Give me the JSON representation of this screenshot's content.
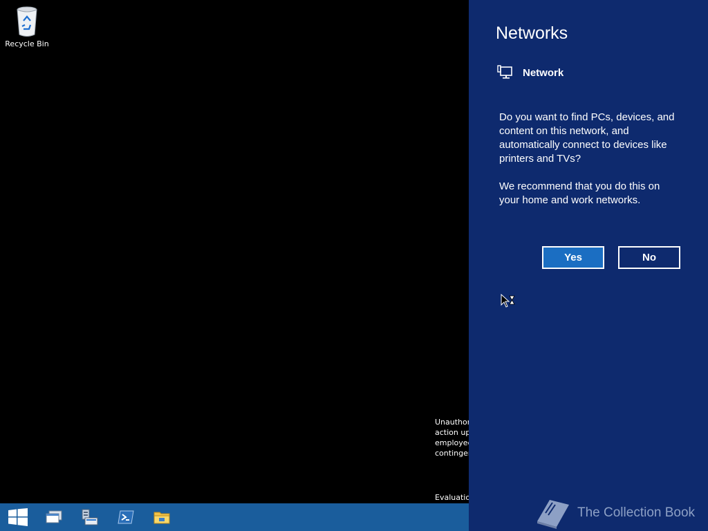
{
  "desktop": {
    "recycle_bin_label": "Recycle Bin",
    "legal_lines": [
      "Unauthor",
      "action up",
      "employee",
      "contingen"
    ],
    "evaluation_text": "Evaluatio"
  },
  "taskbar": {
    "items": [
      {
        "icon": "windows-start-icon"
      },
      {
        "icon": "task-view-icon"
      },
      {
        "icon": "server-manager-icon"
      },
      {
        "icon": "powershell-icon"
      },
      {
        "icon": "file-explorer-icon"
      }
    ],
    "color": "#1a5d9c"
  },
  "networks_pane": {
    "title": "Networks",
    "network_name": "Network",
    "prompt": "Do you want to find PCs, devices, and content on this network, and automatically connect to devices like printers and TVs?",
    "recommendation": "We recommend that you do this on your home and work networks.",
    "yes_label": "Yes",
    "no_label": "No",
    "background": "#0e2a6e",
    "accent": "#1b6ec2"
  },
  "watermark": {
    "text": "The Collection Book"
  }
}
